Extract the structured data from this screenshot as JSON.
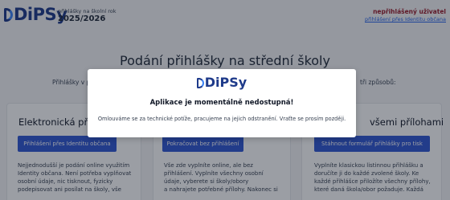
{
  "header": {
    "logo_text": "DiPSy",
    "year_caption": "přihlášky na školní rok",
    "year_value": "2025/2026",
    "user_status": "nepřihlášený uživatel",
    "login_link": "přihlášení přes Identitu občana"
  },
  "main": {
    "title": "Podání přihlášky na střední školy",
    "intro_left": "Přihlášky v p",
    "intro_right": "tři způsobů:"
  },
  "cards": [
    {
      "title": "Elektronická přihlá",
      "button": "Přihlášení přes Identitu občana",
      "text": [
        "Nejjednodušší je podání online využitím",
        "Identity občana. Není potřeba vyplňovat",
        "osobní údaje, nic tisknout, fyzicky",
        "podepisovat ani posílat na školy, vše"
      ]
    },
    {
      "title": "",
      "button": "Pokračovat bez přihlášení",
      "text": [
        "Vše zde vyplníte online, ale bez",
        "přihlášení. Vyplníte všechny osobní",
        "údaje, vyberete si školy/obory",
        "a nahrajete potřebné přílohy. Nakonec si"
      ]
    },
    {
      "title": "všemi přílohami",
      "button": "Stáhnout formulář přihlášky pro tisk",
      "text": [
        "Vyplníte klasickou listinnou přihlášku a",
        "doručíte ji do každé zvolené školy. Ke",
        "každé přihlášce přiložíte všechny přílohy,",
        "které daná škola/obor požaduje. Každá"
      ]
    }
  ],
  "modal": {
    "logo_text": "DiPSy",
    "title": "Aplikace je momentálně nedostupná!",
    "message": "Omlouváme se za technické potíže, pracujeme na jejich odstranění. Vraťte se prosím později."
  }
}
